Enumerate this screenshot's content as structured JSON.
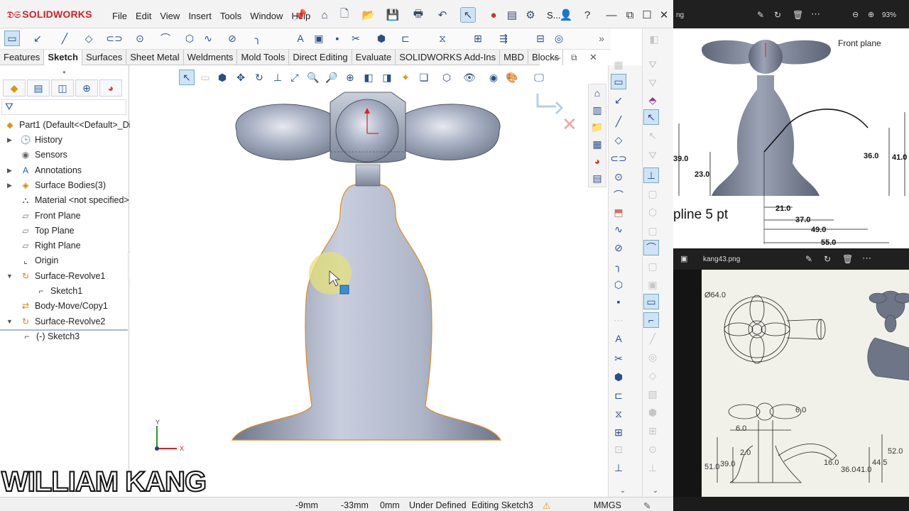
{
  "app": {
    "logo_text": "SOLIDWORKS",
    "menu": [
      "File",
      "Edit",
      "View",
      "Insert",
      "Tools",
      "Window",
      "Help"
    ],
    "search_stub": "S..."
  },
  "tabs": [
    "Features",
    "Sketch",
    "Surfaces",
    "Sheet Metal",
    "Weldments",
    "Mold Tools",
    "Direct Editing",
    "Evaluate",
    "SOLIDWORKS Add-Ins",
    "MBD",
    "Blocks"
  ],
  "active_tab": "Sketch",
  "tree": {
    "root": "Part1  (Default<<Default>_Di",
    "items": [
      {
        "label": "History",
        "icon": "history-icon",
        "expand": true
      },
      {
        "label": "Sensors",
        "icon": "sensors-icon",
        "expand": false
      },
      {
        "label": "Annotations",
        "icon": "annotations-icon",
        "expand": true
      },
      {
        "label": "Surface Bodies(3)",
        "icon": "surface-bodies-icon",
        "expand": true
      },
      {
        "label": "Material <not specified>",
        "icon": "material-icon",
        "expand": false
      },
      {
        "label": "Front Plane",
        "icon": "plane-icon",
        "expand": false
      },
      {
        "label": "Top Plane",
        "icon": "plane-icon",
        "expand": false
      },
      {
        "label": "Right Plane",
        "icon": "plane-icon",
        "expand": false
      },
      {
        "label": "Origin",
        "icon": "origin-icon",
        "expand": false
      },
      {
        "label": "Surface-Revolve1",
        "icon": "revolve-icon",
        "expand": true
      },
      {
        "label": "Sketch1",
        "icon": "sketch-icon",
        "expand": false
      },
      {
        "label": "Body-Move/Copy1",
        "icon": "move-copy-icon",
        "expand": false
      },
      {
        "label": "Surface-Revolve2",
        "icon": "revolve-icon",
        "expand": true
      },
      {
        "label": "(-) Sketch3",
        "icon": "sketch-icon",
        "expand": false
      }
    ]
  },
  "triad": {
    "y": "Y",
    "x": "X"
  },
  "status": {
    "x": "-9mm",
    "y": "-33mm",
    "z": "0mm",
    "state": "Under Defined",
    "mode": "Editing Sketch3",
    "units": "MMGS"
  },
  "watermark": "WILLIAM KANG",
  "preview": {
    "header1": {
      "name": "ng",
      "zoom": "93%"
    },
    "front_plane": "Front plane",
    "spline_text": "pline 5 pt",
    "dims": [
      "39.0",
      "23.0",
      "36.0",
      "41.0",
      "21.0",
      "37.0",
      "49.0",
      "55.0"
    ],
    "header2": {
      "name": "kang43.png"
    },
    "drawing_dims": [
      "Ø64.0",
      "6.0",
      "6.0",
      "2.0",
      "16.0",
      "51.0",
      "39.0",
      "36.0",
      "41.0",
      "44.5",
      "52.0"
    ]
  },
  "colors": {
    "accent": "#d0202a",
    "selection": "#cfe3f7",
    "edge": "#e08a20",
    "model": "#8f98ad"
  }
}
